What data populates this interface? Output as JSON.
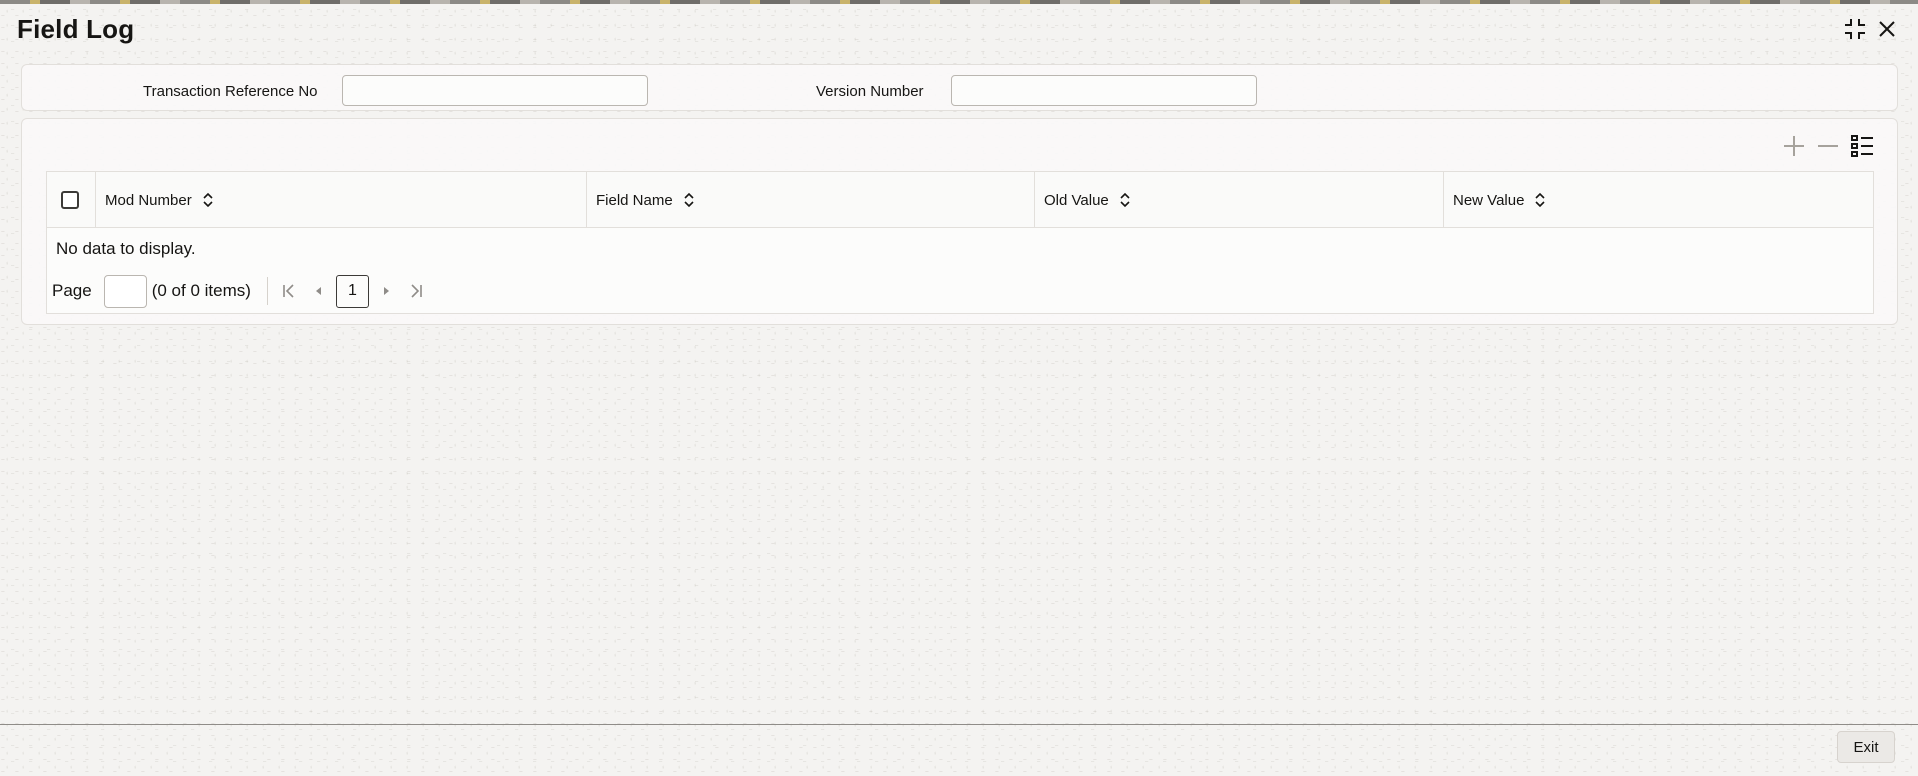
{
  "window": {
    "title": "Field Log",
    "collapse_icon": "collapse-icon",
    "close_icon": "close-icon"
  },
  "criteria": {
    "transaction_reference_label": "Transaction Reference No",
    "transaction_reference_value": "",
    "version_number_label": "Version Number",
    "version_number_value": ""
  },
  "grid": {
    "toolbar_icons": [
      "add-icon",
      "remove-icon",
      "column-list-icon"
    ],
    "columns": [
      {
        "label": "Mod Number"
      },
      {
        "label": "Field Name"
      },
      {
        "label": "Old Value"
      },
      {
        "label": "New Value"
      }
    ],
    "rows": [],
    "empty_message": "No data to display.",
    "pagination": {
      "page_label": "Page",
      "page_input_value": "",
      "items_summary": "(0 of 0 items)",
      "current_page": "1"
    }
  },
  "footer": {
    "exit_label": "Exit"
  },
  "colors": {
    "background": "#f4f3f1",
    "text": "#161513",
    "border": "#e2dfdb"
  }
}
